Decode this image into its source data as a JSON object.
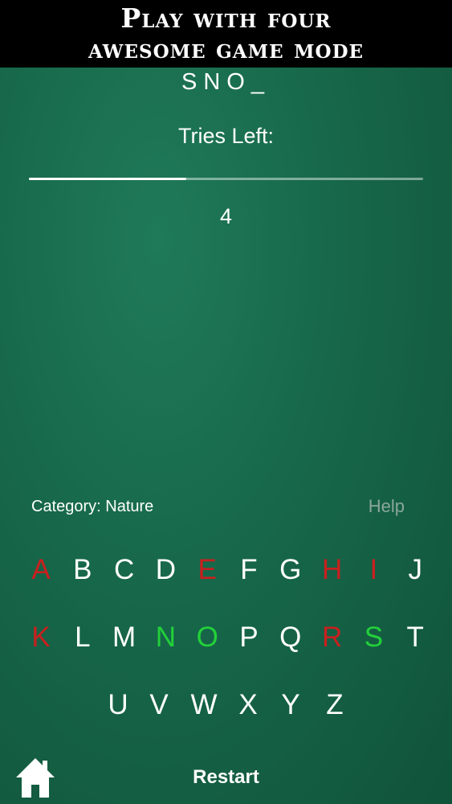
{
  "banner": {
    "line1": "Play with four",
    "line2": "awesome game mode"
  },
  "game": {
    "word_display": "SNO_",
    "tries_label": "Tries Left:",
    "tries_left": "4",
    "tries_progress": 0.4,
    "category": "Category: Nature",
    "help_label": "Help",
    "restart_label": "Restart"
  },
  "keyboard": {
    "rows": [
      [
        "A",
        "B",
        "C",
        "D",
        "E",
        "F",
        "G",
        "H",
        "I",
        "J"
      ],
      [
        "K",
        "L",
        "M",
        "N",
        "O",
        "P",
        "Q",
        "R",
        "S",
        "T"
      ],
      [
        "U",
        "V",
        "W",
        "X",
        "Y",
        "Z"
      ]
    ],
    "wrong": [
      "A",
      "E",
      "H",
      "I",
      "K",
      "R"
    ],
    "correct": [
      "N",
      "O",
      "S"
    ]
  },
  "colors": {
    "wrong": "#c8201e",
    "correct": "#22d13a",
    "unused": "#ffffff",
    "help": "#8aa79a"
  },
  "icons": {
    "home": "home-icon"
  }
}
